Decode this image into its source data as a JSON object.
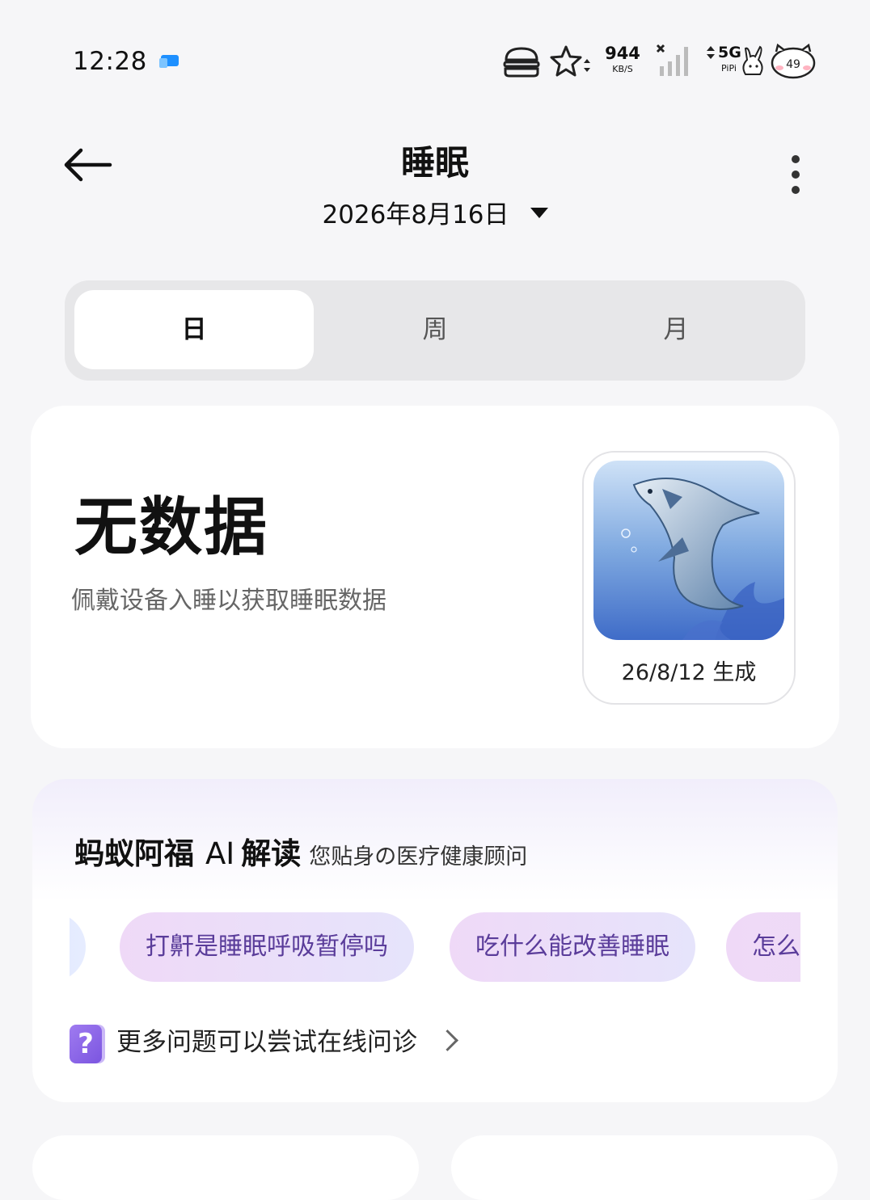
{
  "status_bar": {
    "time": "12:28",
    "network_speed": "944",
    "network_speed_unit": "KB/S",
    "network_type": "5G",
    "carrier_tag": "PiPi",
    "battery": "49"
  },
  "header": {
    "title": "睡眠",
    "date": "2026年8月16日"
  },
  "tabs": [
    {
      "label": "日",
      "active": true
    },
    {
      "label": "周",
      "active": false
    },
    {
      "label": "月",
      "active": false
    }
  ],
  "summary_card": {
    "status": "无数据",
    "hint": "佩戴设备入睡以获取睡眠数据",
    "thumbnail_caption": "26/8/12 生成"
  },
  "ai_card": {
    "title": "蚂蚁阿福",
    "ai": "AI",
    "title_suffix": "解读",
    "subtitle": "您贴身の医疗健康顾问",
    "questions": [
      "打鼾是睡眠呼吸暂停吗",
      "吃什么能改善睡眠",
      "怎么"
    ],
    "more_link": "更多问题可以尝试在线问诊",
    "more_icon_text": "?"
  },
  "colors": {
    "background": "#f6f6f8",
    "chip_text": "#5a3c9a",
    "accent_purple": "#8a63e8"
  }
}
